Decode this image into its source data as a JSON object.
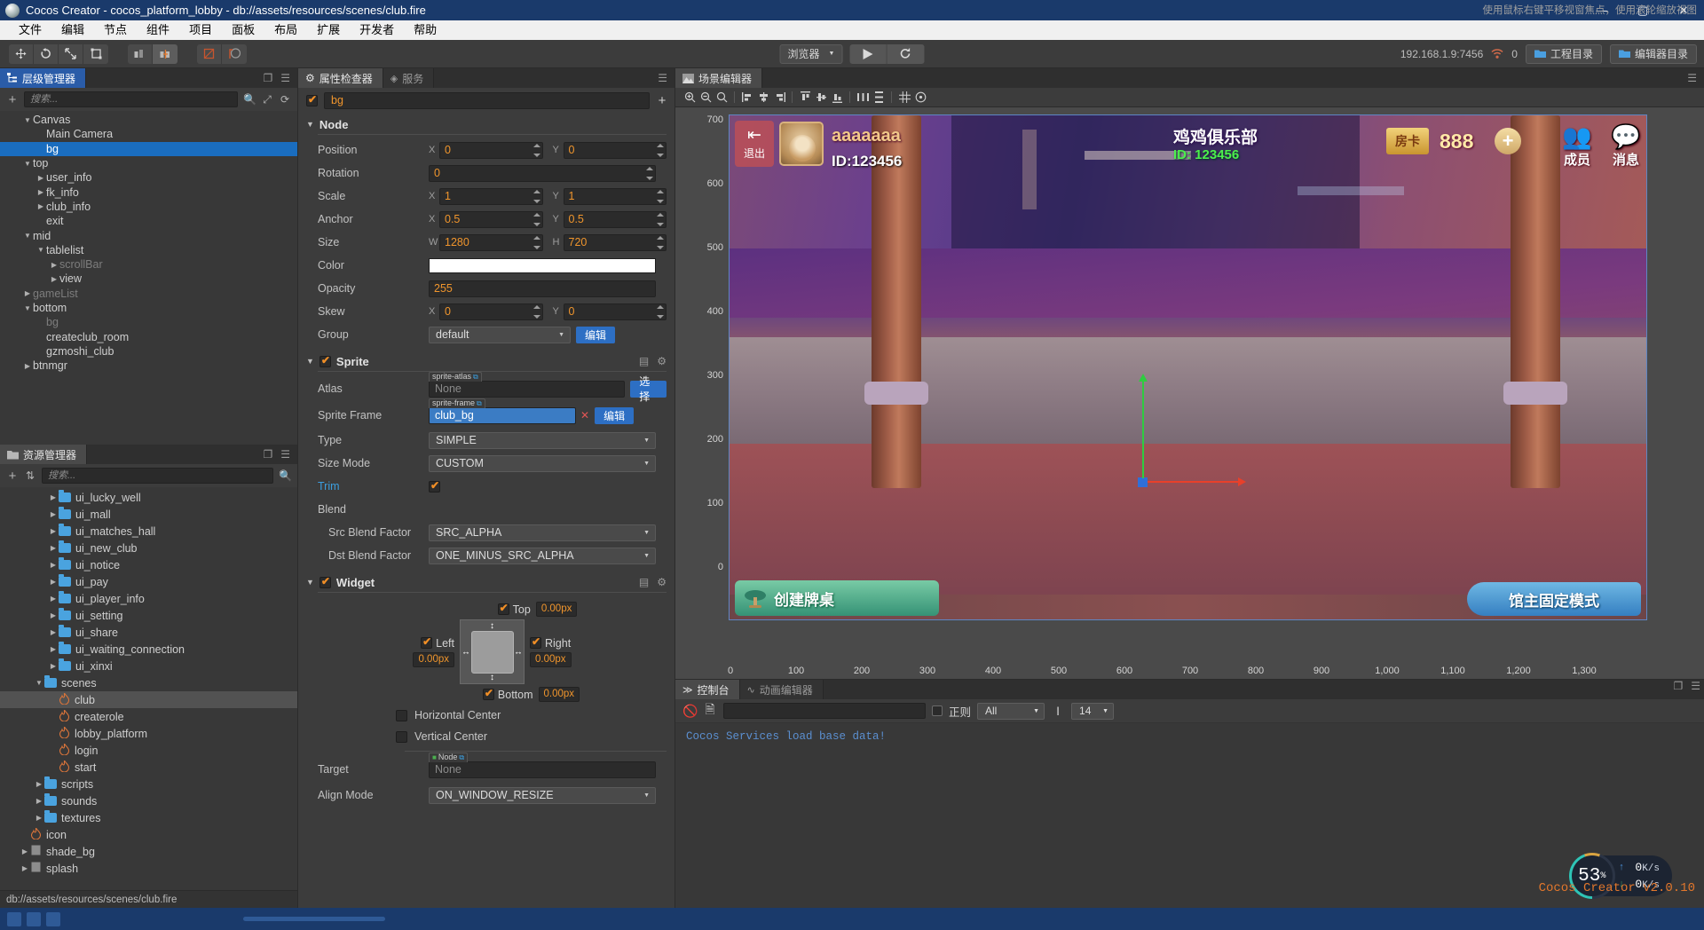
{
  "titlebar": {
    "title": "Cocos Creator - cocos_platform_lobby - db://assets/resources/scenes/club.fire",
    "minimize": "—",
    "maximize": "▢",
    "close": "✕"
  },
  "menubar": {
    "items": [
      "文件",
      "编辑",
      "节点",
      "组件",
      "项目",
      "面板",
      "布局",
      "扩展",
      "开发者",
      "帮助"
    ]
  },
  "toolbar": {
    "browser_label": "浏览器",
    "play_icon": "▶",
    "refresh_icon": "⟳",
    "ip": "192.168.1.9:7456",
    "wifi_icon": "wifi-icon",
    "conn_count": "0",
    "project_dir": "工程目录",
    "editor_dir": "编辑器目录"
  },
  "hierarchy": {
    "tab": "层级管理器",
    "search_placeholder": "搜索...",
    "nodes": [
      {
        "label": "Canvas",
        "depth": 1,
        "arrow": "down",
        "dim": false,
        "sel": false
      },
      {
        "label": "Main Camera",
        "depth": 2,
        "arrow": "none",
        "dim": false,
        "sel": false
      },
      {
        "label": "bg",
        "depth": 2,
        "arrow": "none",
        "dim": false,
        "sel": true
      },
      {
        "label": "top",
        "depth": 1,
        "arrow": "down",
        "dim": false,
        "sel": false
      },
      {
        "label": "user_info",
        "depth": 2,
        "arrow": "right",
        "dim": false,
        "sel": false
      },
      {
        "label": "fk_info",
        "depth": 2,
        "arrow": "right",
        "dim": false,
        "sel": false
      },
      {
        "label": "club_info",
        "depth": 2,
        "arrow": "right",
        "dim": false,
        "sel": false
      },
      {
        "label": "exit",
        "depth": 2,
        "arrow": "none",
        "dim": false,
        "sel": false
      },
      {
        "label": "mid",
        "depth": 1,
        "arrow": "down",
        "dim": false,
        "sel": false
      },
      {
        "label": "tablelist",
        "depth": 2,
        "arrow": "down",
        "dim": false,
        "sel": false
      },
      {
        "label": "scrollBar",
        "depth": 3,
        "arrow": "right",
        "dim": true,
        "sel": false
      },
      {
        "label": "view",
        "depth": 3,
        "arrow": "right",
        "dim": false,
        "sel": false
      },
      {
        "label": "gameList",
        "depth": 1,
        "arrow": "right",
        "dim": true,
        "sel": false
      },
      {
        "label": "bottom",
        "depth": 1,
        "arrow": "down",
        "dim": false,
        "sel": false
      },
      {
        "label": "bg",
        "depth": 2,
        "arrow": "none",
        "dim": true,
        "sel": false
      },
      {
        "label": "createclub_room",
        "depth": 2,
        "arrow": "none",
        "dim": false,
        "sel": false
      },
      {
        "label": "gzmoshi_club",
        "depth": 2,
        "arrow": "none",
        "dim": false,
        "sel": false
      },
      {
        "label": "btnmgr",
        "depth": 1,
        "arrow": "right",
        "dim": false,
        "sel": false
      }
    ]
  },
  "assets": {
    "tab": "资源管理器",
    "search_placeholder": "搜索...",
    "items": [
      {
        "label": "ui_lucky_well",
        "type": "folder",
        "depth": 3,
        "arrow": "right",
        "sel": false
      },
      {
        "label": "ui_mall",
        "type": "folder",
        "depth": 3,
        "arrow": "right",
        "sel": false
      },
      {
        "label": "ui_matches_hall",
        "type": "folder",
        "depth": 3,
        "arrow": "right",
        "sel": false
      },
      {
        "label": "ui_new_club",
        "type": "folder",
        "depth": 3,
        "arrow": "right",
        "sel": false
      },
      {
        "label": "ui_notice",
        "type": "folder",
        "depth": 3,
        "arrow": "right",
        "sel": false
      },
      {
        "label": "ui_pay",
        "type": "folder",
        "depth": 3,
        "arrow": "right",
        "sel": false
      },
      {
        "label": "ui_player_info",
        "type": "folder",
        "depth": 3,
        "arrow": "right",
        "sel": false
      },
      {
        "label": "ui_setting",
        "type": "folder",
        "depth": 3,
        "arrow": "right",
        "sel": false
      },
      {
        "label": "ui_share",
        "type": "folder",
        "depth": 3,
        "arrow": "right",
        "sel": false
      },
      {
        "label": "ui_waiting_connection",
        "type": "folder",
        "depth": 3,
        "arrow": "right",
        "sel": false
      },
      {
        "label": "ui_xinxi",
        "type": "folder",
        "depth": 3,
        "arrow": "right",
        "sel": false
      },
      {
        "label": "scenes",
        "type": "folder",
        "depth": 2,
        "arrow": "down",
        "sel": false
      },
      {
        "label": "club",
        "type": "fire",
        "depth": 3,
        "arrow": "none",
        "sel": true
      },
      {
        "label": "createrole",
        "type": "fire",
        "depth": 3,
        "arrow": "none",
        "sel": false
      },
      {
        "label": "lobby_platform",
        "type": "fire",
        "depth": 3,
        "arrow": "none",
        "sel": false
      },
      {
        "label": "login",
        "type": "fire",
        "depth": 3,
        "arrow": "none",
        "sel": false
      },
      {
        "label": "start",
        "type": "fire",
        "depth": 3,
        "arrow": "none",
        "sel": false
      },
      {
        "label": "scripts",
        "type": "folder",
        "depth": 2,
        "arrow": "right",
        "sel": false
      },
      {
        "label": "sounds",
        "type": "folder",
        "depth": 2,
        "arrow": "right",
        "sel": false
      },
      {
        "label": "textures",
        "type": "folder",
        "depth": 2,
        "arrow": "right",
        "sel": false
      },
      {
        "label": "icon",
        "type": "fire",
        "depth": 1,
        "arrow": "none",
        "sel": false
      },
      {
        "label": "shade_bg",
        "type": "file",
        "depth": 1,
        "arrow": "right",
        "sel": false
      },
      {
        "label": "splash",
        "type": "file",
        "depth": 1,
        "arrow": "right",
        "sel": false
      }
    ],
    "path": "db://assets/resources/scenes/club.fire"
  },
  "inspector": {
    "tab_properties": "属性检查器",
    "tab_services": "服务",
    "node_name": "bg",
    "node_enabled": true,
    "sections": {
      "node": {
        "title": "Node",
        "position": {
          "label": "Position",
          "x": "0",
          "y": "0"
        },
        "rotation": {
          "label": "Rotation",
          "value": "0"
        },
        "scale": {
          "label": "Scale",
          "x": "1",
          "y": "1"
        },
        "anchor": {
          "label": "Anchor",
          "x": "0.5",
          "y": "0.5"
        },
        "size": {
          "label": "Size",
          "w": "1280",
          "h": "720"
        },
        "color": {
          "label": "Color",
          "value": "#FFFFFF"
        },
        "opacity": {
          "label": "Opacity",
          "value": "255"
        },
        "skew": {
          "label": "Skew",
          "x": "0",
          "y": "0"
        },
        "group": {
          "label": "Group",
          "value": "default",
          "edit": "编辑"
        }
      },
      "sprite": {
        "title": "Sprite",
        "enabled": true,
        "atlas": {
          "label": "Atlas",
          "tag": "sprite-atlas",
          "value": "None",
          "btn": "选择"
        },
        "sprite_frame": {
          "label": "Sprite Frame",
          "tag": "sprite-frame",
          "value": "club_bg",
          "edit": "编辑"
        },
        "type": {
          "label": "Type",
          "value": "SIMPLE"
        },
        "size_mode": {
          "label": "Size Mode",
          "value": "CUSTOM"
        },
        "trim": {
          "label": "Trim",
          "checked": true
        },
        "blend": {
          "label": "Blend"
        },
        "src_blend": {
          "label": "Src Blend Factor",
          "value": "SRC_ALPHA"
        },
        "dst_blend": {
          "label": "Dst Blend Factor",
          "value": "ONE_MINUS_SRC_ALPHA"
        }
      },
      "widget": {
        "title": "Widget",
        "enabled": true,
        "top": {
          "label": "Top",
          "checked": true,
          "value": "0.00px"
        },
        "left": {
          "label": "Left",
          "checked": true,
          "value": "0.00px"
        },
        "right": {
          "label": "Right",
          "checked": true,
          "value": "0.00px"
        },
        "bottom": {
          "label": "Bottom",
          "checked": true,
          "value": "0.00px"
        },
        "horizontal_center": {
          "label": "Horizontal Center",
          "checked": false
        },
        "vertical_center": {
          "label": "Vertical Center",
          "checked": false
        },
        "target": {
          "label": "Target",
          "tag": "Node",
          "value": "None"
        },
        "align_mode": {
          "label": "Align Mode",
          "value": "ON_WINDOW_RESIZE"
        }
      }
    }
  },
  "scene": {
    "tab": "场景编辑器",
    "hint": "使用鼠标右键平移视窗焦点，使用滚轮缩放视图",
    "ruler_y": [
      "700",
      "600",
      "500",
      "400",
      "300",
      "200",
      "100",
      "0"
    ],
    "ruler_x": [
      "0",
      "100",
      "200",
      "300",
      "400",
      "500",
      "600",
      "700",
      "800",
      "900",
      "1,000",
      "1,100",
      "1,200",
      "1,300"
    ],
    "game": {
      "exit_label": "退出",
      "user_name": "aaaaaaa",
      "user_id": "ID:123456",
      "club_name": "鸡鸡俱乐部",
      "club_id": "ID: 123456",
      "card_label": "房卡",
      "coin_value": "888",
      "plus_icon": "+",
      "members_label": "成员",
      "message_label": "消息",
      "create_table": "创建牌桌",
      "fixed_mode": "馆主固定模式"
    }
  },
  "console": {
    "tab_console": "控制台",
    "tab_animation": "动画编辑器",
    "regex_label": "正则",
    "filter_level": "All",
    "font_size": "14",
    "log_line": "Cocos Services load base data!"
  },
  "footer": {
    "cpu_percent": "53",
    "percent_sign": "%",
    "upload": "0",
    "download": "0",
    "rate_unit": "K/s",
    "version": "Cocos Creator v2.0.10"
  }
}
